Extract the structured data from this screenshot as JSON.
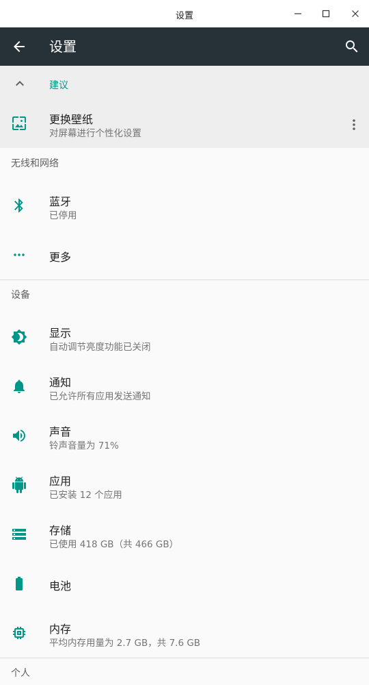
{
  "window": {
    "title": "设置"
  },
  "toolbar": {
    "title": "设置"
  },
  "suggestions": {
    "header": "建议",
    "item": {
      "title": "更换壁纸",
      "summary": "对屏幕进行个性化设置"
    }
  },
  "sections": [
    {
      "category": "无线和网络",
      "items": [
        {
          "title": "蓝牙",
          "summary": "已停用",
          "icon": "bluetooth-icon"
        },
        {
          "title": "更多",
          "summary": "",
          "icon": "more-horiz-icon"
        }
      ]
    },
    {
      "category": "设备",
      "items": [
        {
          "title": "显示",
          "summary": "自动调节亮度功能已关闭",
          "icon": "brightness-icon"
        },
        {
          "title": "通知",
          "summary": "已允许所有应用发送通知",
          "icon": "bell-icon"
        },
        {
          "title": "声音",
          "summary": "铃声音量为 71%",
          "icon": "volume-icon"
        },
        {
          "title": "应用",
          "summary": "已安装 12 个应用",
          "icon": "android-icon"
        },
        {
          "title": "存储",
          "summary": "已使用 418 GB（共 466 GB）",
          "icon": "storage-icon"
        },
        {
          "title": "电池",
          "summary": "",
          "icon": "battery-icon"
        },
        {
          "title": "内存",
          "summary": "平均内存用量为 2.7 GB，共 7.6 GB",
          "icon": "memory-icon"
        }
      ]
    },
    {
      "category": "个人",
      "items": []
    }
  ],
  "colors": {
    "accent": "#009688",
    "toolbar": "#263238",
    "background": "#fafafa"
  }
}
